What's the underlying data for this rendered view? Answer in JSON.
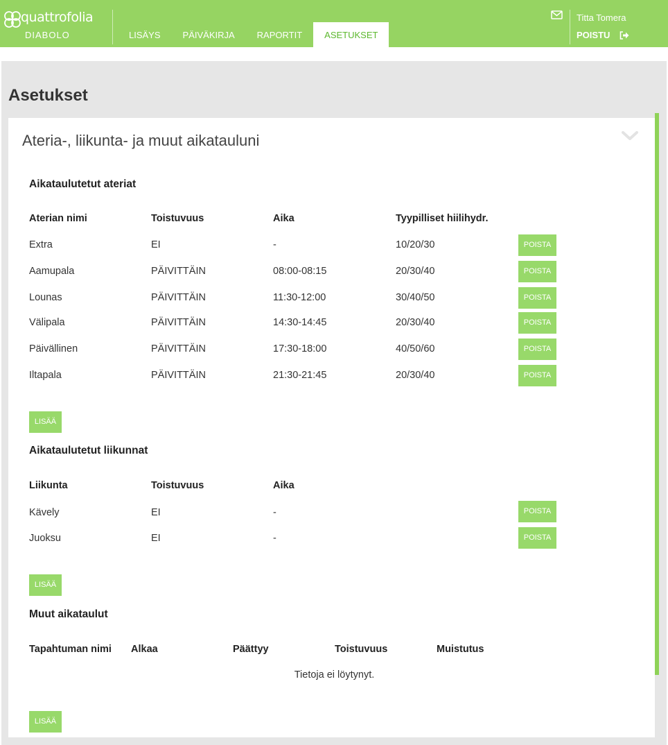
{
  "header": {
    "logo_text": "quattrofolia",
    "logo_sub": "DIABOLO",
    "nav": [
      {
        "label": "LISÄYS",
        "active": false
      },
      {
        "label": "PÄIVÄKIRJA",
        "active": false
      },
      {
        "label": "RAPORTIT",
        "active": false
      },
      {
        "label": "ASETUKSET",
        "active": true
      }
    ],
    "user_name": "Titta Tomera",
    "logout_label": "POISTU",
    "mail_icon": "mail-icon",
    "logout_icon": "sign-out-icon"
  },
  "page": {
    "title": "Asetukset"
  },
  "panel": {
    "title": "Ateria-, liikunta- ja muut aikatauluni",
    "collapse_icon": "chevron-down-icon"
  },
  "meals": {
    "title": "Aikataulutetut ateriat",
    "headers": [
      "Aterian nimi",
      "Toistuvuus",
      "Aika",
      "Tyypilliset hiilihydr."
    ],
    "rows": [
      {
        "name": "Extra",
        "freq": "EI",
        "time": "-",
        "carbs": "10/20/30"
      },
      {
        "name": "Aamupala",
        "freq": "PÄIVITTÄIN",
        "time": "08:00-08:15",
        "carbs": "20/30/40"
      },
      {
        "name": "Lounas",
        "freq": "PÄIVITTÄIN",
        "time": "11:30-12:00",
        "carbs": "30/40/50"
      },
      {
        "name": "Välipala",
        "freq": "PÄIVITTÄIN",
        "time": "14:30-14:45",
        "carbs": "20/30/40"
      },
      {
        "name": "Päivällinen",
        "freq": "PÄIVITTÄIN",
        "time": "17:30-18:00",
        "carbs": "40/50/60"
      },
      {
        "name": "Iltapala",
        "freq": "PÄIVITTÄIN",
        "time": "21:30-21:45",
        "carbs": "20/30/40"
      }
    ],
    "delete_label": "POISTA",
    "add_label": "LISÄÄ"
  },
  "exercises": {
    "title": "Aikataulutetut liikunnat",
    "headers": [
      "Liikunta",
      "Toistuvuus",
      "Aika"
    ],
    "rows": [
      {
        "name": "Kävely",
        "freq": "EI",
        "time": "-"
      },
      {
        "name": "Juoksu",
        "freq": "EI",
        "time": "-"
      }
    ],
    "delete_label": "POISTA",
    "add_label": "LISÄÄ"
  },
  "other": {
    "title": "Muut aikataulut",
    "headers": [
      "Tapahtuman nimi",
      "Alkaa",
      "Päättyy",
      "Toistuvuus",
      "Muistutus"
    ],
    "empty_text": "Tietoja ei löytynyt.",
    "add_label": "LISÄÄ"
  },
  "colors": {
    "brand_green": "#96d462",
    "button_green": "#98d96a",
    "active_tab_text": "#5cb82e"
  }
}
